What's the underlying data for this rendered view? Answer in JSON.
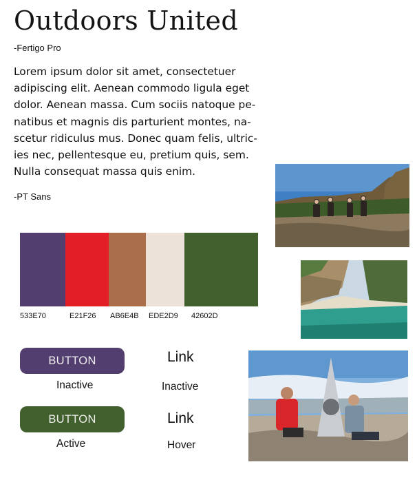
{
  "title": "Outdoors United",
  "heading_font_note": "-Fertigo Pro",
  "body_font_note": "-PT Sans",
  "body_text_lines": [
    "Lorem ipsum dolor sit amet, consectetuer",
    "adipiscing elit. Aenean commodo ligula eget",
    "dolor. Aenean massa. Cum sociis natoque pe-",
    "natibus et magnis dis parturient montes, na-",
    "scetur ridiculus mus. Donec quam felis, ultric-",
    "ies nec, pellentesque eu, pretium quis, sem.",
    "Nulla consequat massa quis enim."
  ],
  "palette": [
    {
      "hex": "533E70",
      "color": "#533E70"
    },
    {
      "hex": "E21F26",
      "color": "#E21F26"
    },
    {
      "hex": "AB6E4B",
      "color": "#AB6E4B"
    },
    {
      "hex": "EDE2D9",
      "color": "#EDE2D9"
    },
    {
      "hex": "42602D",
      "color": "#42602D"
    }
  ],
  "buttons": {
    "inactive": {
      "label": "BUTTON",
      "state": "Inactive",
      "color": "#533E70"
    },
    "active": {
      "label": "BUTTON",
      "state": "Active",
      "color": "#42602D"
    }
  },
  "links": {
    "inactive": {
      "label": "Link",
      "state": "Inactive"
    },
    "hover": {
      "label": "Link",
      "state": "Hover"
    }
  }
}
